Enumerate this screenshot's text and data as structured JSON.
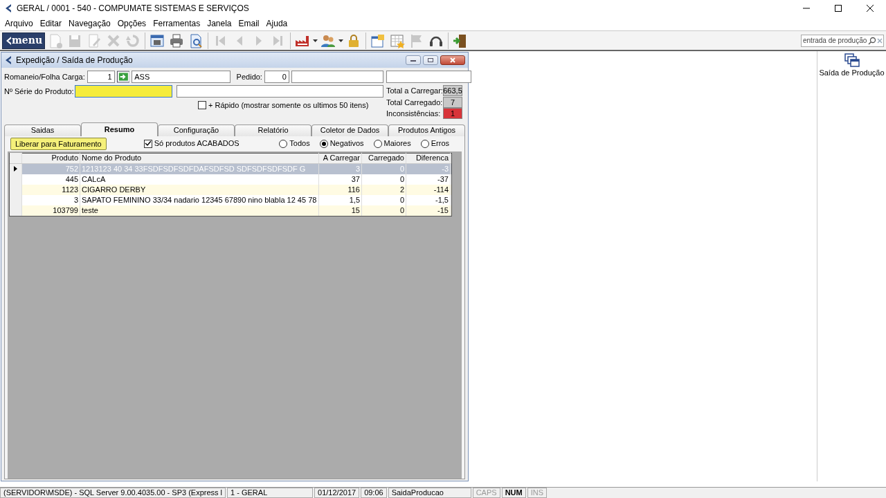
{
  "window": {
    "title": "GERAL / 0001 - 540 - COMPUMATE SISTEMAS E SERVIÇOS"
  },
  "menu": [
    "Arquivo",
    "Editar",
    "Navegação",
    "Opções",
    "Ferramentas",
    "Janela",
    "Email",
    "Ajuda"
  ],
  "toolbar": {
    "menu_button": "menu",
    "items": [
      {
        "kind": "new",
        "disabled": true
      },
      {
        "kind": "save",
        "disabled": true
      },
      {
        "kind": "edit",
        "disabled": true
      },
      {
        "kind": "delete",
        "disabled": true
      },
      {
        "kind": "undo",
        "disabled": true
      },
      {
        "kind": "sep"
      },
      {
        "kind": "window",
        "disabled": false
      },
      {
        "kind": "print",
        "disabled": false
      },
      {
        "kind": "preview",
        "disabled": false
      },
      {
        "kind": "sep"
      },
      {
        "kind": "first",
        "disabled": true
      },
      {
        "kind": "prev",
        "disabled": true
      },
      {
        "kind": "next",
        "disabled": true
      },
      {
        "kind": "last",
        "disabled": true
      },
      {
        "kind": "sep"
      },
      {
        "kind": "factory",
        "disabled": false,
        "dropdown": true
      },
      {
        "kind": "users",
        "disabled": false,
        "dropdown": true
      },
      {
        "kind": "lock",
        "disabled": false
      },
      {
        "kind": "sep"
      },
      {
        "kind": "notes",
        "disabled": false
      },
      {
        "kind": "calendar",
        "disabled": false
      },
      {
        "kind": "flag",
        "disabled": true
      },
      {
        "kind": "headset",
        "disabled": false
      },
      {
        "kind": "sep"
      },
      {
        "kind": "exit",
        "disabled": false
      }
    ],
    "search": {
      "placeholder": "entrada de produção"
    }
  },
  "child_window": {
    "title": "Expedição / Saída de Produção",
    "form": {
      "romaneio_label": "Romaneio/Folha Carga:",
      "romaneio_value": "1",
      "romaneio_name": "ASS",
      "pedido_label": "Pedido:",
      "pedido_value": "0",
      "serie_label": "Nº Série do Produto:",
      "serie_focused": true,
      "rapido": {
        "label": "+ Rápido (mostrar somente os ultimos 50 itens)",
        "checked": false
      }
    },
    "totals": [
      {
        "label": "Total a Carregar:",
        "value": "663,5",
        "color": "#c8c8c8"
      },
      {
        "label": "Total Carregado:",
        "value": "7",
        "color": "#c8c8c8"
      },
      {
        "label": "Inconsistências:",
        "value": "1",
        "color": "#d8343a"
      }
    ],
    "tabs": [
      {
        "label": "Saidas",
        "selected": false
      },
      {
        "label": "Resumo",
        "selected": true
      },
      {
        "label": "Configuração",
        "selected": false
      },
      {
        "label": "Relatório",
        "selected": false
      },
      {
        "label": "Coletor de Dados",
        "selected": false
      },
      {
        "label": "Produtos Antigos",
        "selected": false
      }
    ],
    "release_button": "Liberar para Faturamento",
    "only_finished": {
      "label": "Só produtos ACABADOS",
      "checked": true
    },
    "filters": [
      {
        "label": "Todos",
        "selected": false
      },
      {
        "label": "Negativos",
        "selected": true
      },
      {
        "label": "Maiores",
        "selected": false
      },
      {
        "label": "Erros",
        "selected": false
      }
    ],
    "table": {
      "columns": [
        "Produto",
        "Nome do Produto",
        "A Carregar",
        "Carregado",
        "Diferenca"
      ],
      "rows": [
        {
          "selected": true,
          "cells": [
            "752",
            "1213123 40 34 33FSDFSDFSDFDAFSDFSD SDFSDFSDFSDF G",
            "3",
            "0",
            "-3"
          ]
        },
        {
          "selected": false,
          "cells": [
            "445",
            "CALcA",
            "37",
            "0",
            "-37"
          ]
        },
        {
          "selected": false,
          "cells": [
            "1123",
            "CIGARRO DERBY",
            "116",
            "2",
            "-114"
          ]
        },
        {
          "selected": false,
          "cells": [
            "3",
            "SAPATO FEMININO 33/34 nadario 12345 67890 nino blabla 12 45 78",
            "1,5",
            "0",
            "-1,5"
          ]
        },
        {
          "selected": false,
          "cells": [
            "103799",
            "teste",
            "15",
            "0",
            "-15"
          ]
        }
      ]
    }
  },
  "side_panel": {
    "shortcut": "Saída de Produção"
  },
  "status_bar": [
    {
      "text": "(SERVIDOR\\MSDE) - SQL Server 9.00.4035.00 - SP3 (Express l",
      "kind": "text"
    },
    {
      "text": "1 - GERAL",
      "kind": "text"
    },
    {
      "text": "01/12/2017",
      "kind": "text"
    },
    {
      "text": "09:06",
      "kind": "text"
    },
    {
      "text": "SaidaProducao",
      "kind": "text"
    },
    {
      "text": "CAPS",
      "kind": "key",
      "on": false
    },
    {
      "text": "NUM",
      "kind": "key",
      "on": true
    },
    {
      "text": "INS",
      "kind": "key",
      "on": false
    }
  ]
}
